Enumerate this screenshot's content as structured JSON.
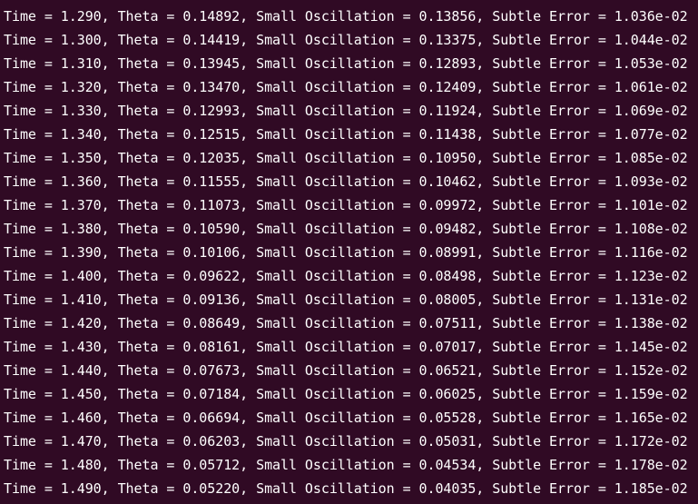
{
  "terminal": {
    "background": "#300a24",
    "foreground": "#ffffff",
    "lines": [
      "Time = 1.290, Theta = 0.14892, Small Oscillation = 0.13856, Subtle Error = 1.036e-02",
      "Time = 1.300, Theta = 0.14419, Small Oscillation = 0.13375, Subtle Error = 1.044e-02",
      "Time = 1.310, Theta = 0.13945, Small Oscillation = 0.12893, Subtle Error = 1.053e-02",
      "Time = 1.320, Theta = 0.13470, Small Oscillation = 0.12409, Subtle Error = 1.061e-02",
      "Time = 1.330, Theta = 0.12993, Small Oscillation = 0.11924, Subtle Error = 1.069e-02",
      "Time = 1.340, Theta = 0.12515, Small Oscillation = 0.11438, Subtle Error = 1.077e-02",
      "Time = 1.350, Theta = 0.12035, Small Oscillation = 0.10950, Subtle Error = 1.085e-02",
      "Time = 1.360, Theta = 0.11555, Small Oscillation = 0.10462, Subtle Error = 1.093e-02",
      "Time = 1.370, Theta = 0.11073, Small Oscillation = 0.09972, Subtle Error = 1.101e-02",
      "Time = 1.380, Theta = 0.10590, Small Oscillation = 0.09482, Subtle Error = 1.108e-02",
      "Time = 1.390, Theta = 0.10106, Small Oscillation = 0.08991, Subtle Error = 1.116e-02",
      "Time = 1.400, Theta = 0.09622, Small Oscillation = 0.08498, Subtle Error = 1.123e-02",
      "Time = 1.410, Theta = 0.09136, Small Oscillation = 0.08005, Subtle Error = 1.131e-02",
      "Time = 1.420, Theta = 0.08649, Small Oscillation = 0.07511, Subtle Error = 1.138e-02",
      "Time = 1.430, Theta = 0.08161, Small Oscillation = 0.07017, Subtle Error = 1.145e-02",
      "Time = 1.440, Theta = 0.07673, Small Oscillation = 0.06521, Subtle Error = 1.152e-02",
      "Time = 1.450, Theta = 0.07184, Small Oscillation = 0.06025, Subtle Error = 1.159e-02",
      "Time = 1.460, Theta = 0.06694, Small Oscillation = 0.05528, Subtle Error = 1.165e-02",
      "Time = 1.470, Theta = 0.06203, Small Oscillation = 0.05031, Subtle Error = 1.172e-02",
      "Time = 1.480, Theta = 0.05712, Small Oscillation = 0.04534, Subtle Error = 1.178e-02",
      "Time = 1.490, Theta = 0.05220, Small Oscillation = 0.04035, Subtle Error = 1.185e-02"
    ]
  }
}
